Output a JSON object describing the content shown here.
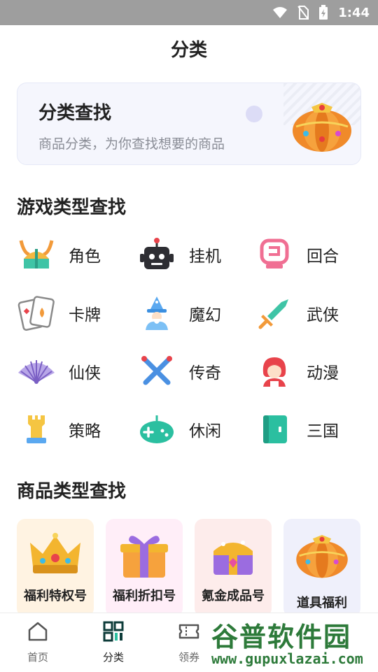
{
  "status_bar": {
    "time": "1:44"
  },
  "header": {
    "title": "分类"
  },
  "banner": {
    "title": "分类查找",
    "subtitle": "商品分类，为你查找想要的商品"
  },
  "game_section": {
    "title": "游戏类型查找",
    "items": [
      {
        "label": "角色",
        "icon": "viking-helmet-icon"
      },
      {
        "label": "挂机",
        "icon": "robot-icon"
      },
      {
        "label": "回合",
        "icon": "turn-box-icon"
      },
      {
        "label": "卡牌",
        "icon": "playing-cards-icon"
      },
      {
        "label": "魔幻",
        "icon": "wizard-icon"
      },
      {
        "label": "武侠",
        "icon": "sword-icon"
      },
      {
        "label": "仙侠",
        "icon": "folding-fan-icon"
      },
      {
        "label": "传奇",
        "icon": "crossed-swords-icon"
      },
      {
        "label": "动漫",
        "icon": "anime-girl-icon"
      },
      {
        "label": "策略",
        "icon": "chess-rook-icon"
      },
      {
        "label": "休闲",
        "icon": "gamepad-icon"
      },
      {
        "label": "三国",
        "icon": "book-icon"
      }
    ]
  },
  "goods_section": {
    "title": "商品类型查找",
    "items": [
      {
        "label": "福利特权号",
        "icon": "crown-icon",
        "bg": "#fff3e2"
      },
      {
        "label": "福利折扣号",
        "icon": "gift-box-icon",
        "bg": "#ffeef8"
      },
      {
        "label": "氪金成品号",
        "icon": "treasure-chest-icon",
        "bg": "#fdeceb"
      },
      {
        "label": "道具福利",
        "icon": "pumpkin-icon",
        "bg": "#eff0fb"
      }
    ]
  },
  "tabbar": {
    "items": [
      {
        "label": "首页",
        "icon": "home-icon"
      },
      {
        "label": "分类",
        "icon": "category-icon"
      },
      {
        "label": "领券",
        "icon": "coupon-icon"
      }
    ]
  },
  "watermark": {
    "title": "谷普软件园",
    "url": "www.gupuxlazai.com"
  },
  "colors": {
    "accent": "#2bbfa0",
    "status_bar": "#9e9e9e",
    "red": "#e8434b",
    "pink": "#ff6f9c"
  }
}
